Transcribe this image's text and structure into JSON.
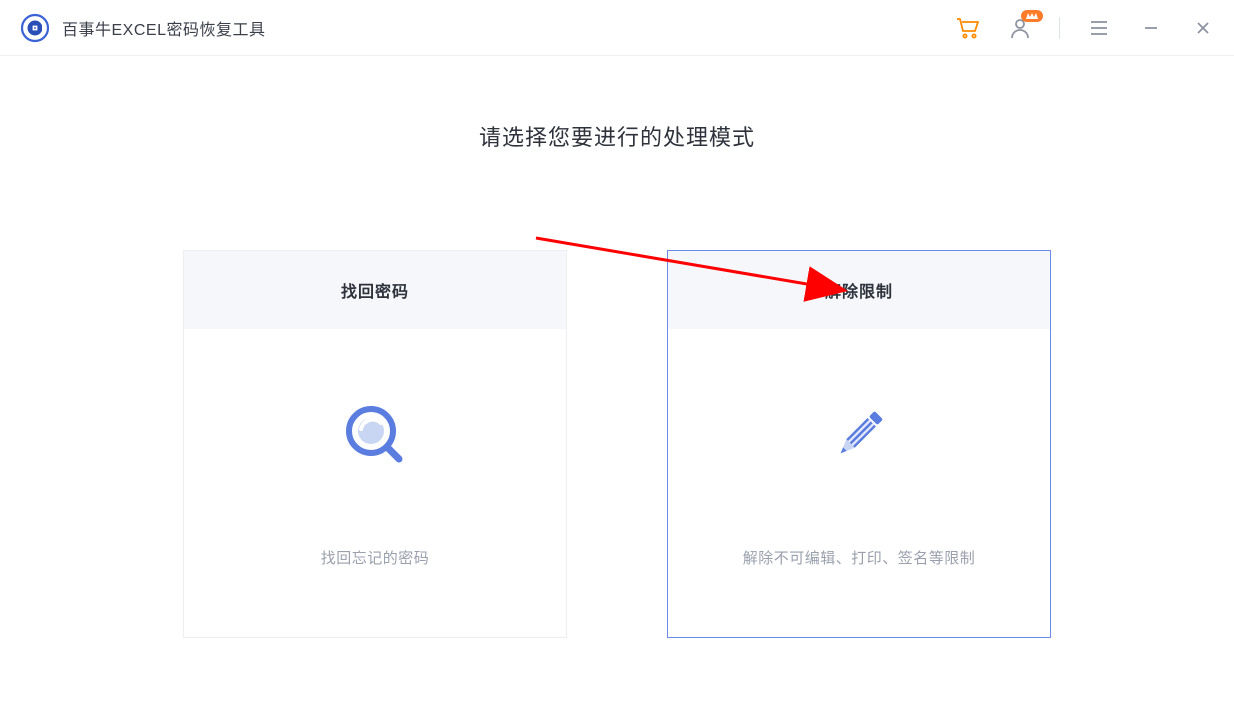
{
  "header": {
    "title": "百事牛EXCEL密码恢复工具"
  },
  "main": {
    "heading": "请选择您要进行的处理模式",
    "cards": [
      {
        "title": "找回密码",
        "desc": "找回忘记的密码",
        "icon": "search-lens-icon",
        "selected": false
      },
      {
        "title": "解除限制",
        "desc": "解除不可编辑、打印、签名等限制",
        "icon": "edit-pencil-icon",
        "selected": true
      }
    ]
  },
  "colors": {
    "accent_blue": "#5b7de0",
    "accent_orange": "#ff8a00",
    "card_header_bg": "#f5f7fb",
    "selected_border": "#6a8be8"
  }
}
